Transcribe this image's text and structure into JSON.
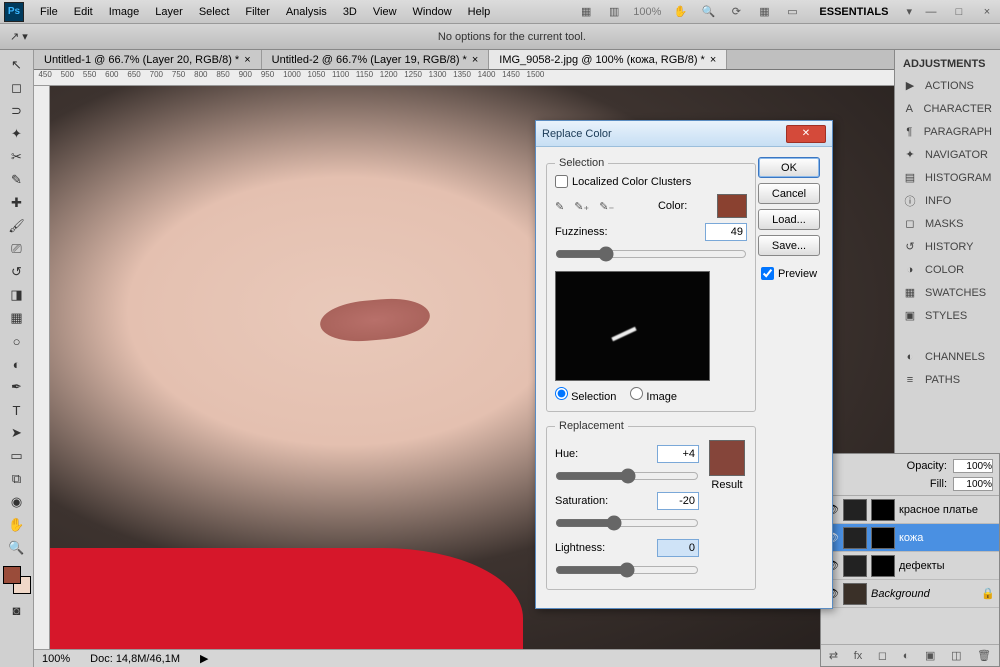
{
  "menu": [
    "File",
    "Edit",
    "Image",
    "Layer",
    "Select",
    "Filter",
    "Analysis",
    "3D",
    "View",
    "Window",
    "Help"
  ],
  "zoom_label": "100%",
  "workspace_label": "ESSENTIALS",
  "options_msg": "No options for the current tool.",
  "doc_tabs": [
    "Untitled-1 @ 66.7% (Layer 20, RGB/8) *",
    "Untitled-2 @ 66.7% (Layer 19, RGB/8) *",
    "IMG_9058-2.jpg @ 100% (кожа, RGB/8) *"
  ],
  "active_tab": 2,
  "status": {
    "zoom": "100%",
    "doc": "Doc: 14,8M/46,1M"
  },
  "panels": [
    "ADJUSTMENTS",
    "ACTIONS",
    "CHARACTER",
    "PARAGRAPH",
    "NAVIGATOR",
    "HISTOGRAM",
    "INFO",
    "MASKS",
    "HISTORY",
    "COLOR",
    "SWATCHES",
    "STYLES",
    "CHANNELS",
    "PATHS"
  ],
  "panel_icons": [
    "◐",
    "▶",
    "A",
    "¶",
    "✦",
    "▤",
    "ⓘ",
    "◻",
    "↺",
    "◑",
    "▦",
    "▣",
    "◐",
    "≡"
  ],
  "layers": {
    "opacity_label": "Opacity:",
    "opacity": "100%",
    "fill_label": "Fill:",
    "fill": "100%",
    "items": [
      {
        "name": "красное платье"
      },
      {
        "name": "кожа",
        "selected": true
      },
      {
        "name": "дефекты"
      },
      {
        "name": "Background",
        "bg": true
      }
    ]
  },
  "dialog": {
    "title": "Replace Color",
    "selection_legend": "Selection",
    "localized_label": "Localized Color Clusters",
    "color_label": "Color:",
    "selection_color": "#8a4130",
    "fuzziness_label": "Fuzziness:",
    "fuzziness": "49",
    "radio_selection": "Selection",
    "radio_image": "Image",
    "replacement_legend": "Replacement",
    "hue_label": "Hue:",
    "hue": "+4",
    "sat_label": "Saturation:",
    "sat": "-20",
    "light_label": "Lightness:",
    "light": "0",
    "result_label": "Result",
    "result_color": "#85453a",
    "ok": "OK",
    "cancel": "Cancel",
    "load": "Load...",
    "save": "Save...",
    "preview": "Preview"
  }
}
